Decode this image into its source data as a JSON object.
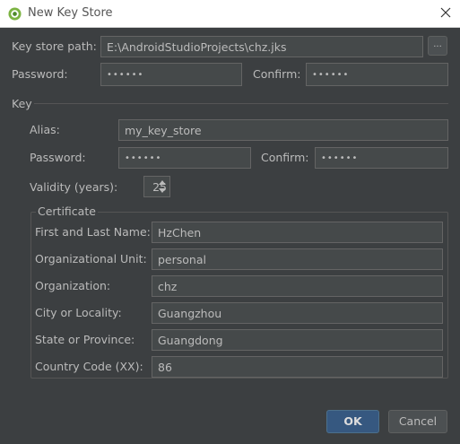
{
  "window": {
    "title": "New Key Store"
  },
  "keystore": {
    "path_label": "Key store path:",
    "path_value": "E:\\AndroidStudioProjects\\chz.jks",
    "browse_label": "...",
    "password_label": "Password:",
    "password_value": "••••••",
    "confirm_label": "Confirm:",
    "confirm_value": "••••••"
  },
  "key": {
    "section_label": "Key",
    "alias_label": "Alias:",
    "alias_value": "my_key_store",
    "password_label": "Password:",
    "password_value": "••••••",
    "confirm_label": "Confirm:",
    "confirm_value": "••••••",
    "validity_label": "Validity (years):",
    "validity_value": "25"
  },
  "certificate": {
    "title": "Certificate",
    "fields": [
      {
        "label": "First and Last Name:",
        "value": "HzChen"
      },
      {
        "label": "Organizational Unit:",
        "value": "personal"
      },
      {
        "label": "Organization:",
        "value": "chz"
      },
      {
        "label": "City or Locality:",
        "value": "Guangzhou"
      },
      {
        "label": "State or Province:",
        "value": "Guangdong"
      },
      {
        "label": "Country Code (XX):",
        "value": "86"
      }
    ]
  },
  "buttons": {
    "ok_label": "OK",
    "cancel_label": "Cancel"
  },
  "colors": {
    "background": "#3c3f41",
    "field": "#45494a",
    "accent": "#365880"
  },
  "icons": {
    "app": "android-studio-icon",
    "close": "close-icon",
    "spinner": "spinner-arrows-icon"
  }
}
